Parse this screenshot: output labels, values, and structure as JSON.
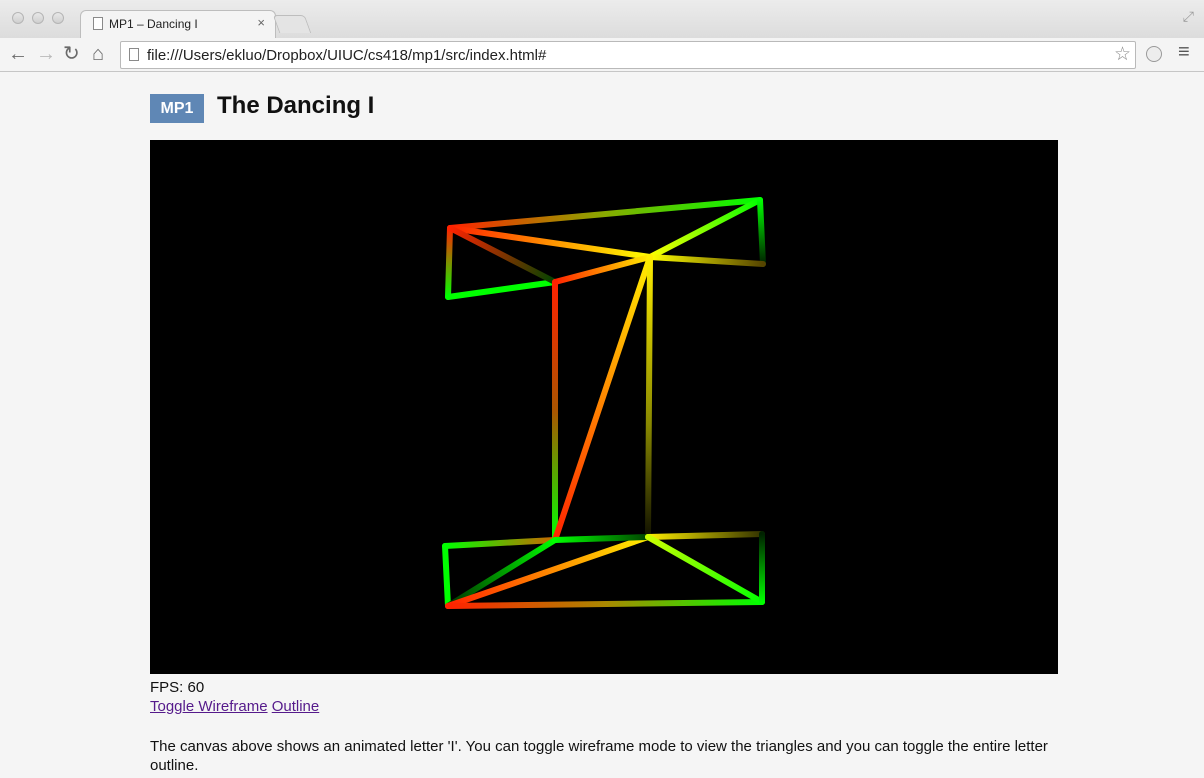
{
  "browser": {
    "tab_title": "MP1 – Dancing I",
    "tab_close": "×",
    "url": "file:///Users/ekluo/Dropbox/UIUC/cs418/mp1/src/index.html#",
    "back_glyph": "←",
    "forward_glyph": "→",
    "reload_glyph": "↻",
    "home_glyph": "⌂",
    "star_glyph": "☆",
    "menu_glyph": "≡"
  },
  "page": {
    "badge": "MP1",
    "title": "The Dancing I",
    "fps_label": "FPS: 60",
    "link_wireframe": "Toggle Wireframe",
    "link_outline": "Outline",
    "description": "The canvas above shows an animated letter 'I'. You can toggle wireframe mode to view the triangles and you can toggle the entire letter outline."
  },
  "colors": {
    "canvas_bg": "#000000",
    "badge_bg": "#5f87b5",
    "link": "#551a8b",
    "vertex_red": "#ff2200",
    "vertex_green": "#00ff00",
    "vertex_yellow": "#ffff00"
  },
  "icons": {
    "tab_page": "page-icon",
    "omnibox_page": "page-icon",
    "bookmark": "star-icon",
    "menu": "hamburger-menu-icon"
  }
}
